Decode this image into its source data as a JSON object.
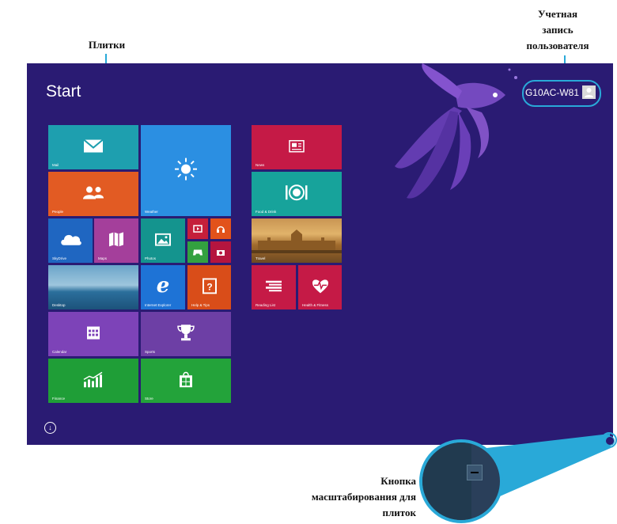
{
  "annotations": {
    "tiles_label": "Плитки",
    "account_label_1": "Учетная",
    "account_label_2": "запись",
    "account_label_3": "пользователя",
    "zoom_label_1": "Кнопка",
    "zoom_label_2": "масштабирования для",
    "zoom_label_3": "плиток"
  },
  "screen": {
    "title": "Start",
    "user_name": "G10AC-W81",
    "colors": {
      "background": "#2a1b73",
      "callout": "#29a9d8"
    }
  },
  "tiles": {
    "mail": {
      "label": "Mail",
      "icon": "envelope-icon",
      "color": "#1e9faf"
    },
    "weather": {
      "label": "Weather",
      "icon": "sun-icon",
      "color": "#2b8fe2"
    },
    "people": {
      "label": "People",
      "icon": "people-icon",
      "color": "#e25b23"
    },
    "skydrive": {
      "label": "SkyDrive",
      "icon": "cloud-icon",
      "color": "#1f66c1"
    },
    "maps": {
      "label": "Maps",
      "icon": "map-icon",
      "color": "#a43f9b"
    },
    "photos": {
      "label": "Photos",
      "icon": "picture-icon",
      "color": "#14948e"
    },
    "video": {
      "label": "",
      "icon": "video-icon",
      "color": "#c51f3a"
    },
    "music": {
      "label": "",
      "icon": "headphones-icon",
      "color": "#e2521b"
    },
    "games": {
      "label": "",
      "icon": "gamepad-icon",
      "color": "#33a140"
    },
    "camera": {
      "label": "",
      "icon": "camera-icon",
      "color": "#b5153f"
    },
    "desktop": {
      "label": "Desktop",
      "icon": "landscape-image",
      "color": "#3a86b8"
    },
    "ie": {
      "label": "Internet Explorer",
      "icon": "ie-icon",
      "color": "#1e73d6"
    },
    "help": {
      "label": "Help & Tips",
      "icon": "help-icon",
      "color": "#d94d19"
    },
    "calendar": {
      "label": "Calendar",
      "icon": "calendar-icon",
      "color": "#7d43b8"
    },
    "sports": {
      "label": "Sports",
      "icon": "trophy-icon",
      "color": "#6d3fa5"
    },
    "finance": {
      "label": "Finance",
      "icon": "chart-icon",
      "color": "#1f9e37"
    },
    "store": {
      "label": "Store",
      "icon": "store-icon",
      "color": "#23a33a"
    },
    "news": {
      "label": "News",
      "icon": "newspaper-icon",
      "color": "#c51a46"
    },
    "food": {
      "label": "Food & Drink",
      "icon": "plate-icon",
      "color": "#17a39b"
    },
    "travel": {
      "label": "Travel",
      "icon": "city-image",
      "color": "#9a6a28"
    },
    "reading": {
      "label": "Reading List",
      "icon": "list-icon",
      "color": "#c51a46"
    },
    "health": {
      "label": "Health & Fitness",
      "icon": "heartbeat-icon",
      "color": "#c51a46"
    }
  }
}
